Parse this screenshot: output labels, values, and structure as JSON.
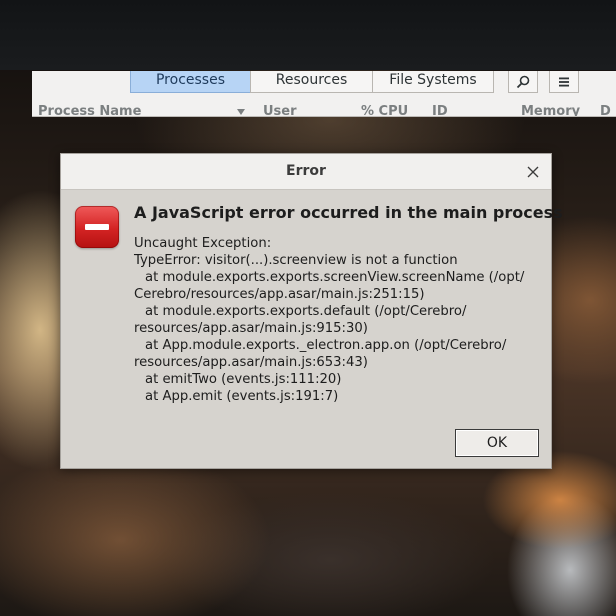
{
  "system_monitor": {
    "tabs": [
      {
        "label": "Processes",
        "active": true
      },
      {
        "label": "Resources",
        "active": false
      },
      {
        "label": "File Systems",
        "active": false
      }
    ],
    "columns": [
      "Process Name",
      "User",
      "% CPU",
      "ID",
      "Memory",
      "D"
    ],
    "toolbar_icons": [
      "search-icon",
      "hamburger-menu-icon"
    ]
  },
  "dialog": {
    "title": "Error",
    "heading": "A JavaScript error occurred in the main process",
    "message_lines": [
      "Uncaught Exception:",
      "TypeError: visitor(...).screenview is not a function",
      "    at module.exports.exports.screenView.screenName (/opt/",
      "Cerebro/resources/app.asar/main.js:251:15)",
      "    at module.exports.exports.default (/opt/Cerebro/",
      "resources/app.asar/main.js:915:30)",
      "    at App.module.exports._electron.app.on (/opt/Cerebro/",
      "resources/app.asar/main.js:653:43)",
      "    at emitTwo (events.js:111:20)",
      "    at App.emit (events.js:191:7)"
    ],
    "ok_label": "OK",
    "icon": "error-stop-icon",
    "close_icon": "close-icon"
  },
  "colors": {
    "active_tab": "#b7d4f5",
    "error_icon": "#d32323",
    "dialog_bg": "#d6d3ce"
  }
}
